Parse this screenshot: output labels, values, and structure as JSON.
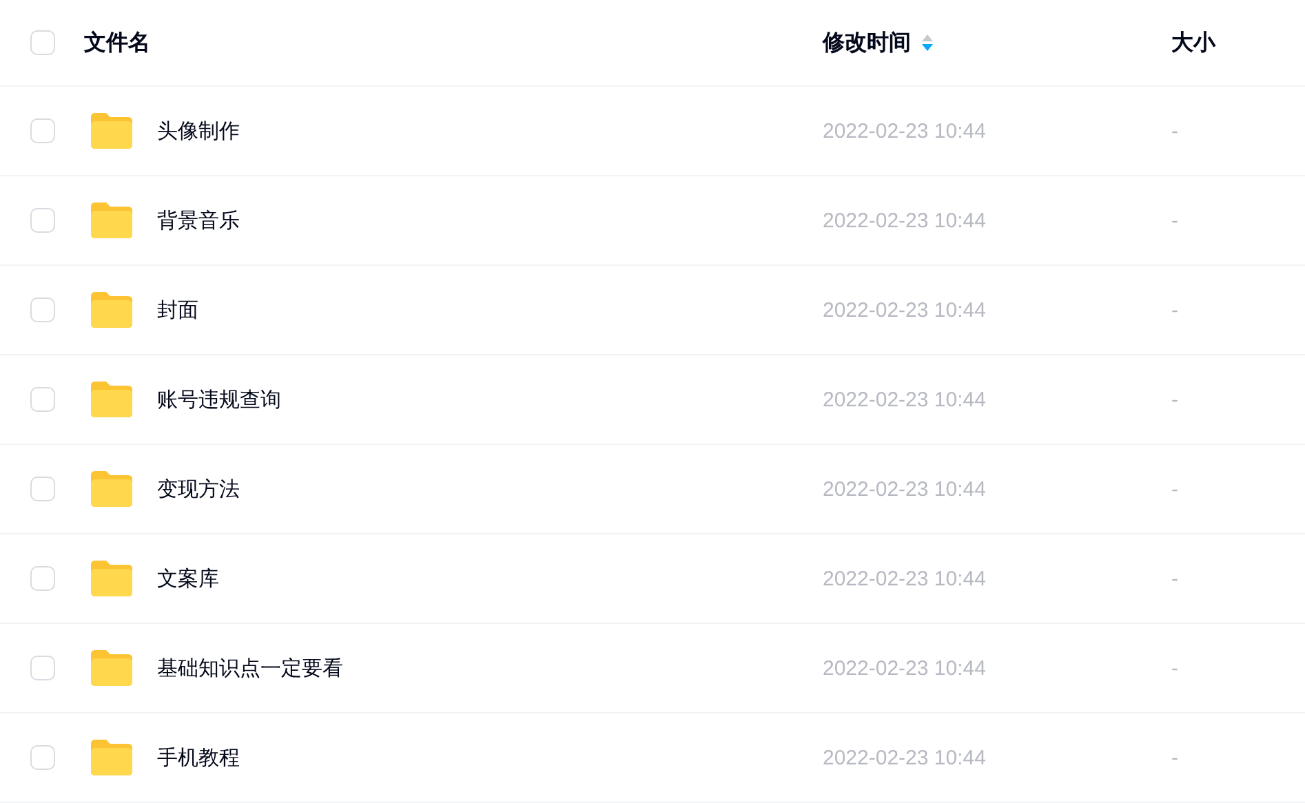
{
  "table": {
    "select_all": {
      "checked": false
    },
    "columns": [
      {
        "label": "文件名"
      },
      {
        "label": "修改时间",
        "sorted_descending": true
      },
      {
        "label": "大小"
      }
    ],
    "rows": [
      {
        "checked": false,
        "name": "头像制作",
        "modified": "2022-02-23 10:44",
        "size": "-"
      },
      {
        "checked": false,
        "name": "背景音乐",
        "modified": "2022-02-23 10:44",
        "size": "-"
      },
      {
        "checked": false,
        "name": "封面",
        "modified": "2022-02-23 10:44",
        "size": "-"
      },
      {
        "checked": false,
        "name": "账号违规查询",
        "modified": "2022-02-23 10:44",
        "size": "-"
      },
      {
        "checked": false,
        "name": "变现方法",
        "modified": "2022-02-23 10:44",
        "size": "-"
      },
      {
        "checked": false,
        "name": "文案库",
        "modified": "2022-02-23 10:44",
        "size": "-"
      },
      {
        "checked": false,
        "name": "基础知识点一定要看",
        "modified": "2022-02-23 10:44",
        "size": "-"
      },
      {
        "checked": false,
        "name": "手机教程",
        "modified": "2022-02-23 10:44",
        "size": "-"
      }
    ]
  }
}
